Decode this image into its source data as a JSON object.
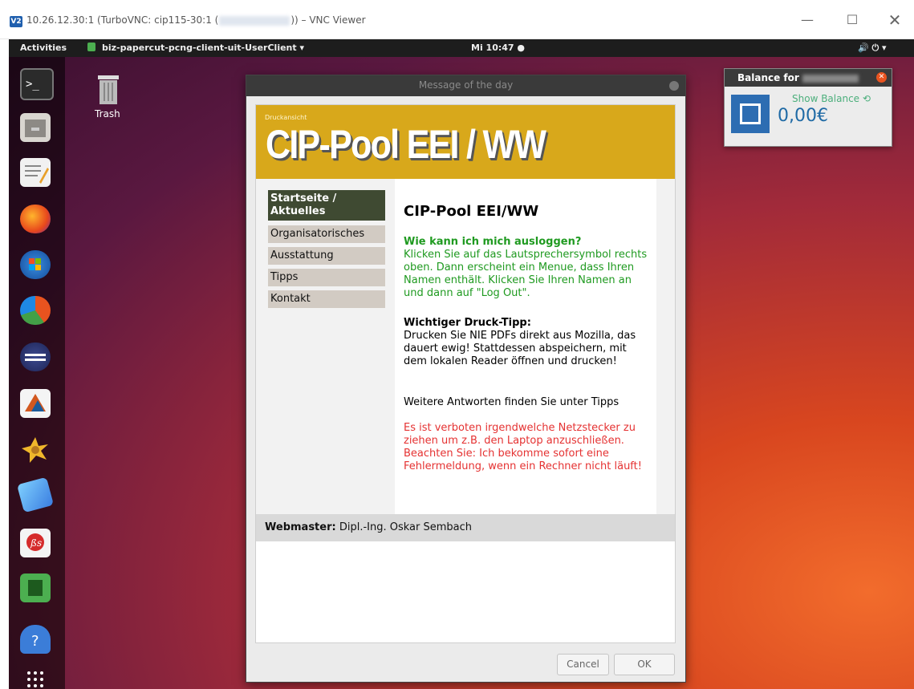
{
  "vnc": {
    "logo": "V2",
    "title_prefix": "10.26.12.30:1 (TurboVNC: cip115-30:1 (",
    "title_suffix": ")) – VNC Viewer",
    "min_glyph": "—",
    "max_glyph": "☐",
    "close_glyph": "✕"
  },
  "topbar": {
    "activities": "Activities",
    "app_label": "biz-papercut-pcng-client-uit-UserClient ▾",
    "clock": "Mi 10:47 ●",
    "system_icons": "🔊  ⏻  ▾"
  },
  "desktop": {
    "trash_label": "Trash"
  },
  "balance": {
    "title": "Balance for",
    "show_label": "Show Balance ⟲",
    "value": "0,00€",
    "colors": {
      "header": "#3b3b3b",
      "value": "#1f6aa5",
      "show": "#4caf7c"
    }
  },
  "dialog": {
    "title": "Message of the day",
    "druckansicht": "Druckansicht",
    "banner_title": "CIP-Pool EEI / WW",
    "nav": [
      {
        "label": "Startseite / Aktuelles",
        "active": true
      },
      {
        "label": "Organisatorisches"
      },
      {
        "label": "Ausstattung"
      },
      {
        "label": "Tipps"
      },
      {
        "label": "Kontakt"
      }
    ],
    "main_title": "CIP-Pool EEI/WW",
    "question_heading": "Wie kann ich mich ausloggen?",
    "question_body": "Klicken Sie auf das Lautsprechersymbol rechts oben. Dann erscheint ein Menue, dass Ihren Namen enthält. Klicken Sie Ihren Namen an und dann auf \"Log Out\".",
    "tip_heading": "Wichtiger Druck-Tipp:",
    "tip_body": "Drucken Sie NIE PDFs direkt aus Mozilla, das dauert ewig! Stattdessen abspeichern, mit dem lokalen Reader öffnen und drucken!",
    "more": "Weitere Antworten finden Sie unter Tipps",
    "warning": "Es ist verboten irgendwelche Netzstecker zu ziehen um z.B. den Laptop anzuschließen. Beachten Sie: Ich bekomme sofort eine Fehlermeldung, wenn ein Rechner nicht läuft!",
    "footer_label": "Webmaster:",
    "footer_name": " Dipl.-Ing. Oskar Sembach",
    "cancel": "Cancel",
    "ok": "OK",
    "colors": {
      "banner": "#d8a81b",
      "nav_active": "#3f4a32",
      "green_text": "#1f9a20",
      "red_text": "#e53232"
    }
  }
}
